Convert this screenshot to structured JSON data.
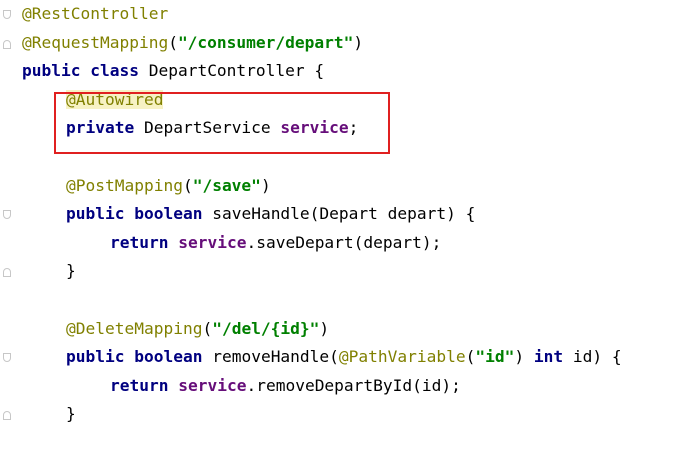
{
  "editor": {
    "lines": [
      {
        "tokens": [
          {
            "t": "@RestController",
            "c": "ann"
          }
        ]
      },
      {
        "tokens": [
          {
            "t": "@RequestMapping",
            "c": "ann"
          },
          {
            "t": "(",
            "c": "plain"
          },
          {
            "t": "\"/consumer/depart\"",
            "c": "str"
          },
          {
            "t": ")",
            "c": "plain"
          }
        ]
      },
      {
        "tokens": [
          {
            "t": "public",
            "c": "kw"
          },
          {
            "t": " ",
            "c": "plain"
          },
          {
            "t": "class",
            "c": "kw"
          },
          {
            "t": " DepartController {",
            "c": "plain"
          }
        ]
      },
      {
        "indent": 1,
        "tokens": [
          {
            "t": "@Autowired",
            "c": "ann hl"
          }
        ]
      },
      {
        "indent": 1,
        "tokens": [
          {
            "t": "private",
            "c": "kw"
          },
          {
            "t": " DepartService ",
            "c": "plain"
          },
          {
            "t": "service",
            "c": "fld"
          },
          {
            "t": ";",
            "c": "plain"
          }
        ]
      },
      {
        "tokens": []
      },
      {
        "indent": 1,
        "tokens": [
          {
            "t": "@PostMapping",
            "c": "ann"
          },
          {
            "t": "(",
            "c": "plain"
          },
          {
            "t": "\"/save\"",
            "c": "str"
          },
          {
            "t": ")",
            "c": "plain"
          }
        ]
      },
      {
        "indent": 1,
        "tokens": [
          {
            "t": "public",
            "c": "kw"
          },
          {
            "t": " ",
            "c": "plain"
          },
          {
            "t": "boolean",
            "c": "kw"
          },
          {
            "t": " saveHandle(Depart depart) {",
            "c": "plain"
          }
        ]
      },
      {
        "indent": 2,
        "tokens": [
          {
            "t": "return",
            "c": "kw"
          },
          {
            "t": " ",
            "c": "plain"
          },
          {
            "t": "service",
            "c": "fld"
          },
          {
            "t": ".saveDepart(depart);",
            "c": "plain"
          }
        ]
      },
      {
        "indent": 1,
        "tokens": [
          {
            "t": "}",
            "c": "plain"
          }
        ]
      },
      {
        "tokens": []
      },
      {
        "indent": 1,
        "tokens": [
          {
            "t": "@DeleteMapping",
            "c": "ann"
          },
          {
            "t": "(",
            "c": "plain"
          },
          {
            "t": "\"/del/{id}\"",
            "c": "str"
          },
          {
            "t": ")",
            "c": "plain"
          }
        ]
      },
      {
        "indent": 1,
        "tokens": [
          {
            "t": "public",
            "c": "kw"
          },
          {
            "t": " ",
            "c": "plain"
          },
          {
            "t": "boolean",
            "c": "kw"
          },
          {
            "t": " removeHandle(",
            "c": "plain"
          },
          {
            "t": "@PathVariable",
            "c": "ann"
          },
          {
            "t": "(",
            "c": "plain"
          },
          {
            "t": "\"id\"",
            "c": "str"
          },
          {
            "t": ") ",
            "c": "plain"
          },
          {
            "t": "int",
            "c": "kw"
          },
          {
            "t": " id) {",
            "c": "plain"
          }
        ]
      },
      {
        "indent": 2,
        "tokens": [
          {
            "t": "return",
            "c": "kw"
          },
          {
            "t": " ",
            "c": "plain"
          },
          {
            "t": "service",
            "c": "fld"
          },
          {
            "t": ".removeDepartById(id);",
            "c": "plain"
          }
        ]
      },
      {
        "indent": 1,
        "tokens": [
          {
            "t": "}",
            "c": "plain"
          }
        ]
      }
    ]
  },
  "colors": {
    "annotation": "#808000",
    "keyword": "#000080",
    "string": "#008000",
    "field": "#660e7a",
    "highlight_border": "#e02020"
  }
}
